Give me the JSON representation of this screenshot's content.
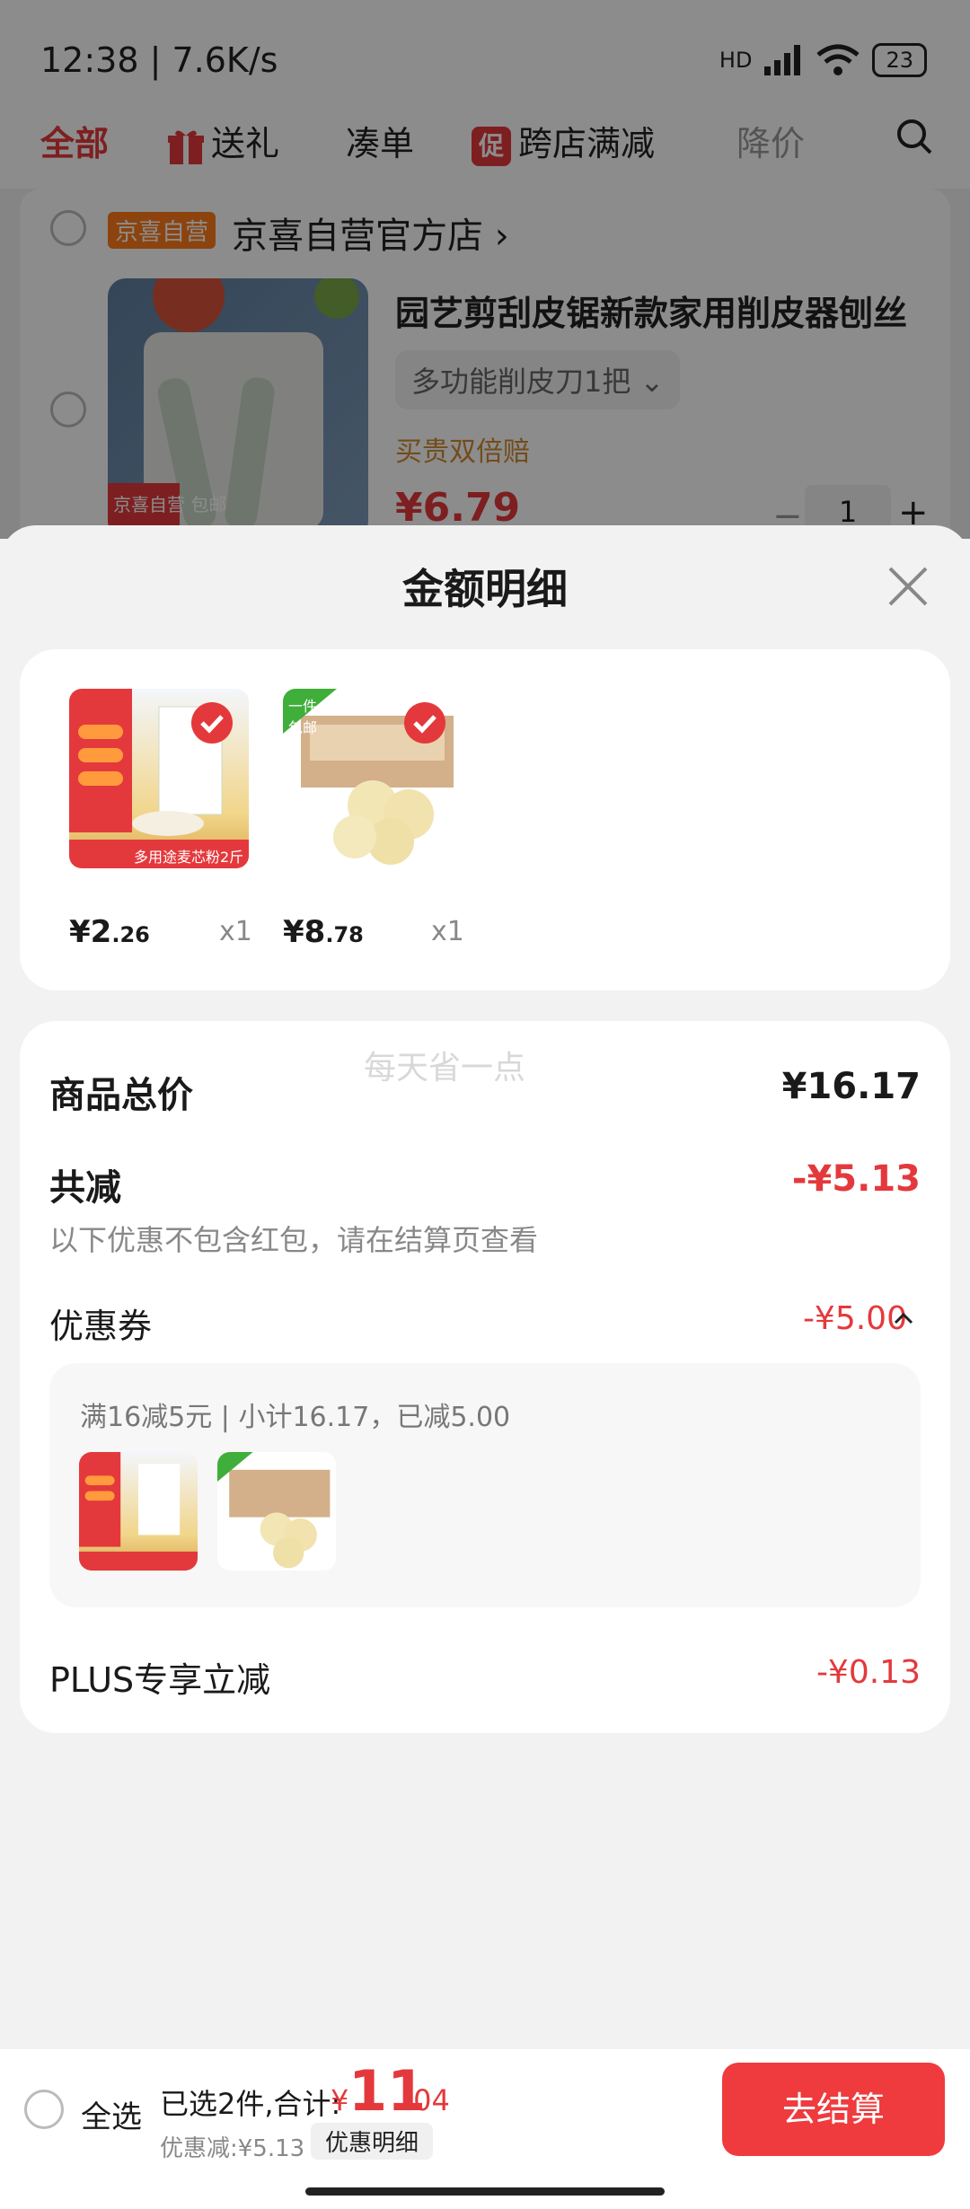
{
  "status_bar": {
    "time": "12:38 | 7.6K/s",
    "network": "HD",
    "battery": "23"
  },
  "tabs": [
    {
      "label": "全部"
    },
    {
      "label": "送礼"
    },
    {
      "label": "凑单"
    },
    {
      "label": "跨店满减",
      "icon_text": "促"
    },
    {
      "label": "降价"
    }
  ],
  "store": {
    "badge": "京喜自营",
    "name": "京喜自营官方店",
    "arrow": "›"
  },
  "background_product": {
    "title": "园艺剪刮皮锯新款家用削皮器刨丝",
    "spec": "多功能削皮刀1把",
    "tag": "买贵双倍赔",
    "price": "¥6.79",
    "qty": "1",
    "image_badge": "京喜自营 包邮"
  },
  "sheet": {
    "title": "金额明细",
    "items": [
      {
        "price_int": "¥2",
        "price_dec": ".26",
        "qty": "x1",
        "image_label": "多用途麦芯粉2斤"
      },
      {
        "price_int": "¥8",
        "price_dec": ".78",
        "qty": "x1",
        "image_label": "一件包邮"
      }
    ],
    "watermark": "每天省一点",
    "total_label": "商品总价",
    "total_value": "¥16.17",
    "discount_label": "共减",
    "discount_value": "-¥5.13",
    "discount_note": "以下优惠不包含红包，请在结算页查看",
    "coupon_label": "优惠券",
    "coupon_value": "-¥5.00",
    "coupon_info": "满16减5元 | 小计16.17，已减5.00",
    "plus_label": "PLUS专享立减",
    "plus_value": "-¥0.13"
  },
  "bottom": {
    "select_all": "全选",
    "selected": "已选2件,合计:",
    "currency": "¥",
    "total_int": "11",
    "total_dec": ".04",
    "discount": "优惠减:¥5.13",
    "detail_button": "优惠明细",
    "checkout": "去结算"
  },
  "colors": {
    "accent": "#e4393c",
    "checkout": "#ef3b3e",
    "sheet_bg": "#f2f2f2"
  }
}
